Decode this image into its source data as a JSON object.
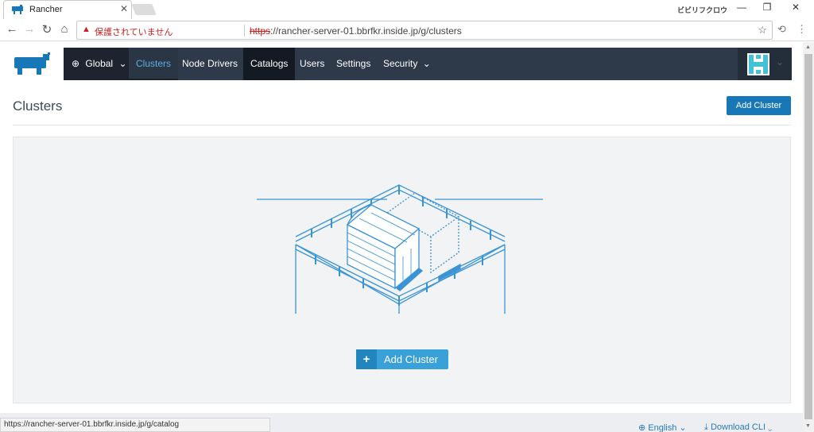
{
  "browser": {
    "tab_title": "Rancher",
    "window_label": "ビビリフクロウ",
    "insecure_label": "保護されていません",
    "url_scheme": "https",
    "url_rest": "://rancher-server-01.bbrfkr.inside.jp/g/clusters",
    "status_url": "https://rancher-server-01.bbrfkr.inside.jp/g/catalog"
  },
  "nav": {
    "global": "Global",
    "items": [
      "Clusters",
      "Node Drivers",
      "Catalogs",
      "Users",
      "Settings",
      "Security"
    ]
  },
  "page": {
    "title": "Clusters",
    "add_button": "Add Cluster",
    "empty_add_button": "Add Cluster"
  },
  "footer": {
    "language": "English",
    "download": "Download CLI"
  },
  "colors": {
    "nav_bg": "#2e3a4a",
    "accent": "#1877b7",
    "illustration": "#3a93d4"
  }
}
